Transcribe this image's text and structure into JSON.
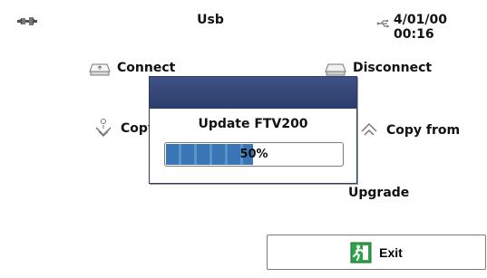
{
  "header": {
    "title": "Usb",
    "datetime": "4/01/00 00:16",
    "left_icon": "connection-icon",
    "usb_icon": "usb-icon"
  },
  "actions": {
    "connect": {
      "label": "Connect",
      "icon": "connect-icon"
    },
    "disconnect": {
      "label": "Disconnect",
      "icon": "disconnect-icon"
    },
    "copy_to": {
      "label": "Copy to",
      "icon": "copy-to-icon"
    },
    "copy_from": {
      "label": "Copy from",
      "icon": "copy-from-icon"
    },
    "upgrade": {
      "label": "Upgrade"
    }
  },
  "exit_button": {
    "label": "Exit",
    "icon": "exit-icon",
    "accent_color": "#2ea34a"
  },
  "dialog": {
    "message": "Update FTV200",
    "progress": {
      "percent": 50,
      "label": "50%",
      "fill_color": "#3a76b6"
    },
    "titlebar_color": "#35487a"
  }
}
